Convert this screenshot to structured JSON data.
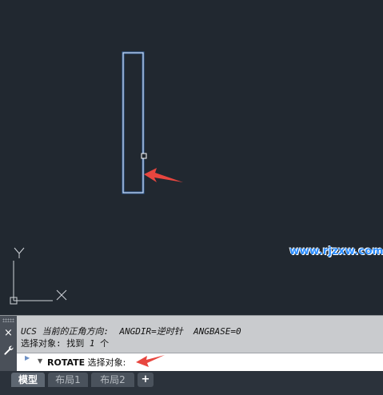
{
  "canvas": {
    "background": "#212830",
    "watermark": "www.rjzxw.com",
    "ucs_icon": {
      "y_label": "Y",
      "x_label": "X"
    },
    "colors": {
      "outline": "#d7e3f3",
      "highlight": "#3f8df4",
      "arrow": "#e8463f"
    }
  },
  "command_line": {
    "close_icon": "×",
    "settings_icon": "wrench-icon",
    "history": {
      "line1_prefix": "UCS 当前的正角方向:  ",
      "line1_dir": "ANGDIR=逆时针  ANGBASE=0",
      "line2_prefix": "选择对象: 找到 ",
      "line2_count": "1",
      "line2_suffix": " 个"
    },
    "prompt": {
      "command": "ROTATE",
      "text": " 选择对象:"
    }
  },
  "tabs": {
    "items": [
      "模型",
      "布局1",
      "布局2"
    ],
    "active": "模型",
    "add_label": "+"
  }
}
